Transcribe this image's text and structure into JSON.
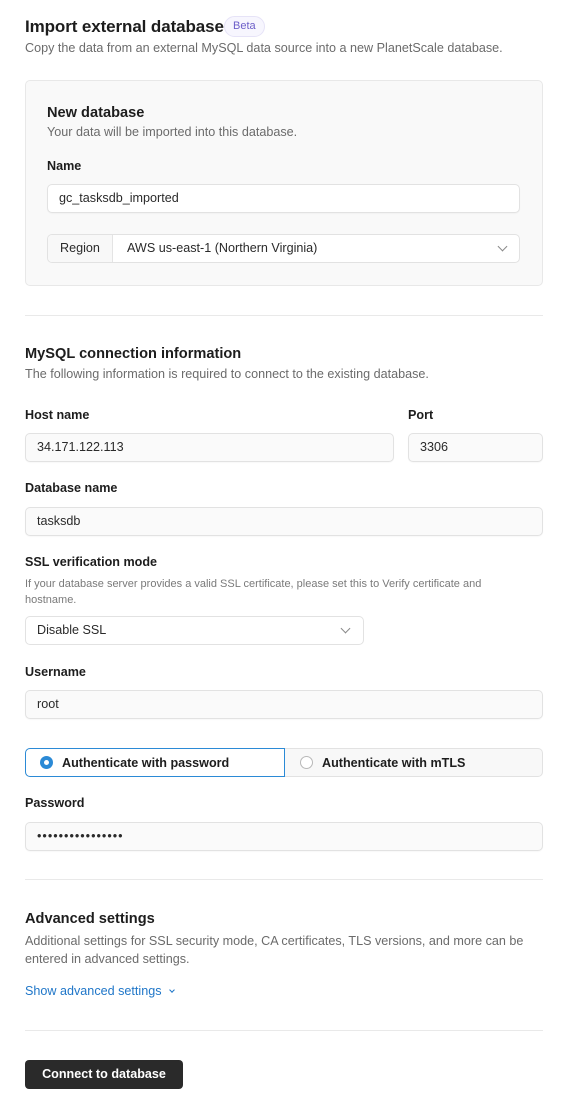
{
  "header": {
    "title": "Import external database",
    "badge": "Beta",
    "description": "Copy the data from an external MySQL data source into a new PlanetScale database."
  },
  "new_database": {
    "title": "New database",
    "description": "Your data will be imported into this database.",
    "name_label": "Name",
    "name_value": "gc_tasksdb_imported",
    "region_label": "Region",
    "region_value": "AWS us-east-1 (Northern Virginia)",
    "region_icon": "chevron-down-icon"
  },
  "connection": {
    "title": "MySQL connection information",
    "description": "The following information is required to connect to the existing database.",
    "host_label": "Host name",
    "host_value": "34.171.122.113",
    "port_label": "Port",
    "port_value": "3306",
    "dbname_label": "Database name",
    "dbname_value": "tasksdb",
    "ssl_label": "SSL verification mode",
    "ssl_help": "If your database server provides a valid SSL certificate, please set this to Verify certificate and hostname.",
    "ssl_value": "Disable SSL",
    "username_label": "Username",
    "username_value": "root",
    "auth_options": [
      {
        "label": "Authenticate with password",
        "selected": true
      },
      {
        "label": "Authenticate with mTLS",
        "selected": false
      }
    ],
    "password_label": "Password",
    "password_value": "••••••••••••••••"
  },
  "advanced": {
    "title": "Advanced settings",
    "description": "Additional settings for SSL security mode, CA certificates, TLS versions, and more can be entered in advanced settings.",
    "toggle_label": "Show advanced settings"
  },
  "actions": {
    "connect_label": "Connect to database"
  },
  "colors": {
    "accent": "#2b8ad6",
    "link": "#1f76c8",
    "primary_button": "#2a2a2a",
    "badge_text": "#6d5fc9"
  }
}
